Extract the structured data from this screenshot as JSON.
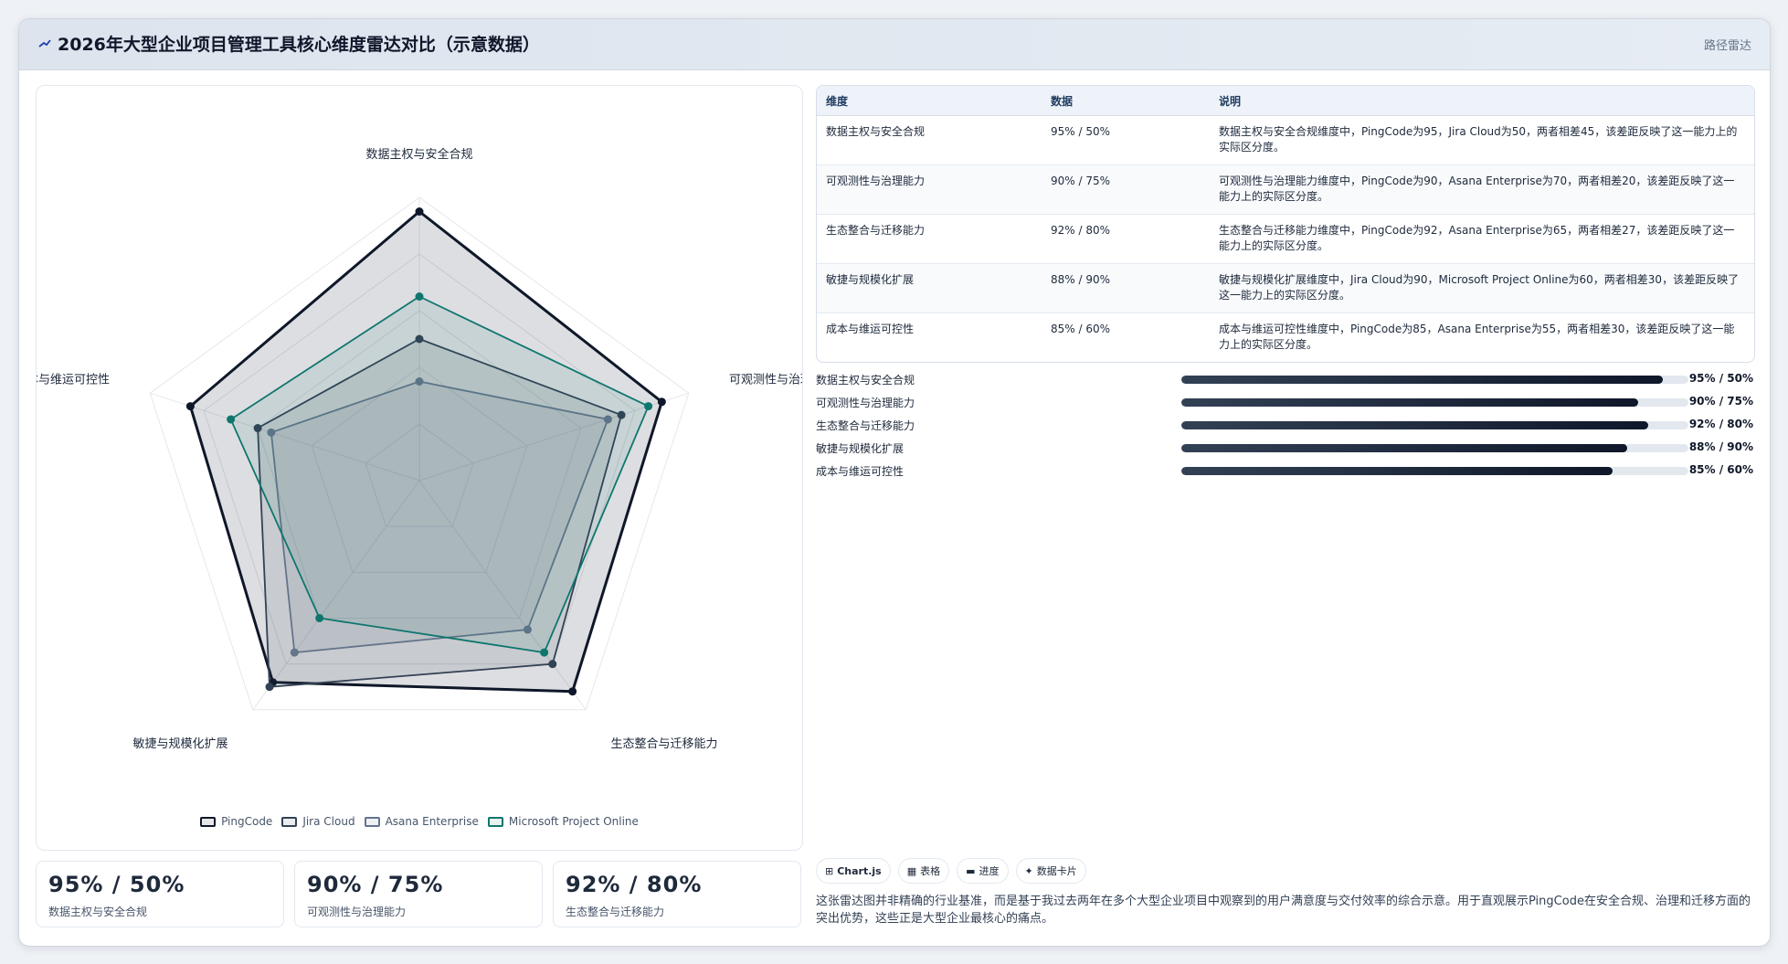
{
  "header": {
    "title": "2026年大型企业项目管理工具核心维度雷达对比（示意数据）",
    "tag": "路径雷达"
  },
  "colors": {
    "PingCode": "#0f172a",
    "Jira Cloud": "#334155",
    "Asana Enterprise": "#64748b",
    "Microsoft Project Online": "#0f766e"
  },
  "chart_data": {
    "type": "radar",
    "axes": [
      "数据主权与安全合规",
      "可观测性与治理能力",
      "生态整合与迁移能力",
      "敏捷与规模化扩展",
      "成本与维运可控性"
    ],
    "rlim": [
      0,
      100
    ],
    "series": [
      {
        "name": "PingCode",
        "values": [
          95,
          90,
          92,
          88,
          85
        ]
      },
      {
        "name": "Jira Cloud",
        "values": [
          50,
          75,
          80,
          90,
          60
        ]
      },
      {
        "name": "Asana Enterprise",
        "values": [
          35,
          70,
          65,
          75,
          55
        ]
      },
      {
        "name": "Microsoft Project Online",
        "values": [
          65,
          85,
          75,
          60,
          70
        ]
      }
    ],
    "legend_position": "bottom-center",
    "grid": true
  },
  "table": {
    "headers": [
      "维度",
      "数据",
      "说明"
    ],
    "rows": [
      {
        "dim": "数据主权与安全合规",
        "value": "95% / 50%",
        "desc": "数据主权与安全合规维度中，PingCode为95，Jira Cloud为50，两者相差45，该差距反映了这一能力上的实际区分度。"
      },
      {
        "dim": "可观测性与治理能力",
        "value": "90% / 75%",
        "desc": "可观测性与治理能力维度中，PingCode为90，Asana Enterprise为70，两者相差20，该差距反映了这一能力上的实际区分度。"
      },
      {
        "dim": "生态整合与迁移能力",
        "value": "92% / 80%",
        "desc": "生态整合与迁移能力维度中，PingCode为92，Asana Enterprise为65，两者相差27，该差距反映了这一能力上的实际区分度。"
      },
      {
        "dim": "敏捷与规模化扩展",
        "value": "88% / 90%",
        "desc": "敏捷与规模化扩展维度中，Jira Cloud为90，Microsoft Project Online为60，两者相差30，该差距反映了这一能力上的实际区分度。"
      },
      {
        "dim": "成本与维运可控性",
        "value": "85% / 60%",
        "desc": "成本与维运可控性维度中，PingCode为85，Asana Enterprise为55，两者相差30，该差距反映了这一能力上的实际区分度。"
      }
    ]
  },
  "bars": [
    {
      "label": "数据主权与安全合规",
      "value": "95% / 50%",
      "fill": 0.95
    },
    {
      "label": "可观测性与治理能力",
      "value": "90% / 75%",
      "fill": 0.9
    },
    {
      "label": "生态整合与迁移能力",
      "value": "92% / 80%",
      "fill": 0.92
    },
    {
      "label": "敏捷与规模化扩展",
      "value": "88% / 90%",
      "fill": 0.88
    },
    {
      "label": "成本与维运可控性",
      "value": "85% / 60%",
      "fill": 0.85
    }
  ],
  "cards": [
    {
      "big": "95% / 50%",
      "sub": "数据主权与安全合规"
    },
    {
      "big": "90% / 75%",
      "sub": "可观测性与治理能力"
    },
    {
      "big": "92% / 80%",
      "sub": "生态整合与迁移能力"
    }
  ],
  "chips": [
    {
      "icon": "⊞",
      "label": "Chart.js"
    },
    {
      "icon": "▦",
      "label": "表格"
    },
    {
      "icon": "▬",
      "label": "进度"
    },
    {
      "icon": "✦",
      "label": "数据卡片"
    }
  ],
  "note": "这张雷达图并非精确的行业基准，而是基于我过去两年在多个大型企业项目中观察到的用户满意度与交付效率的综合示意。用于直观展示PingCode在安全合规、治理和迁移方面的突出优势，这些正是大型企业最核心的痛点。"
}
